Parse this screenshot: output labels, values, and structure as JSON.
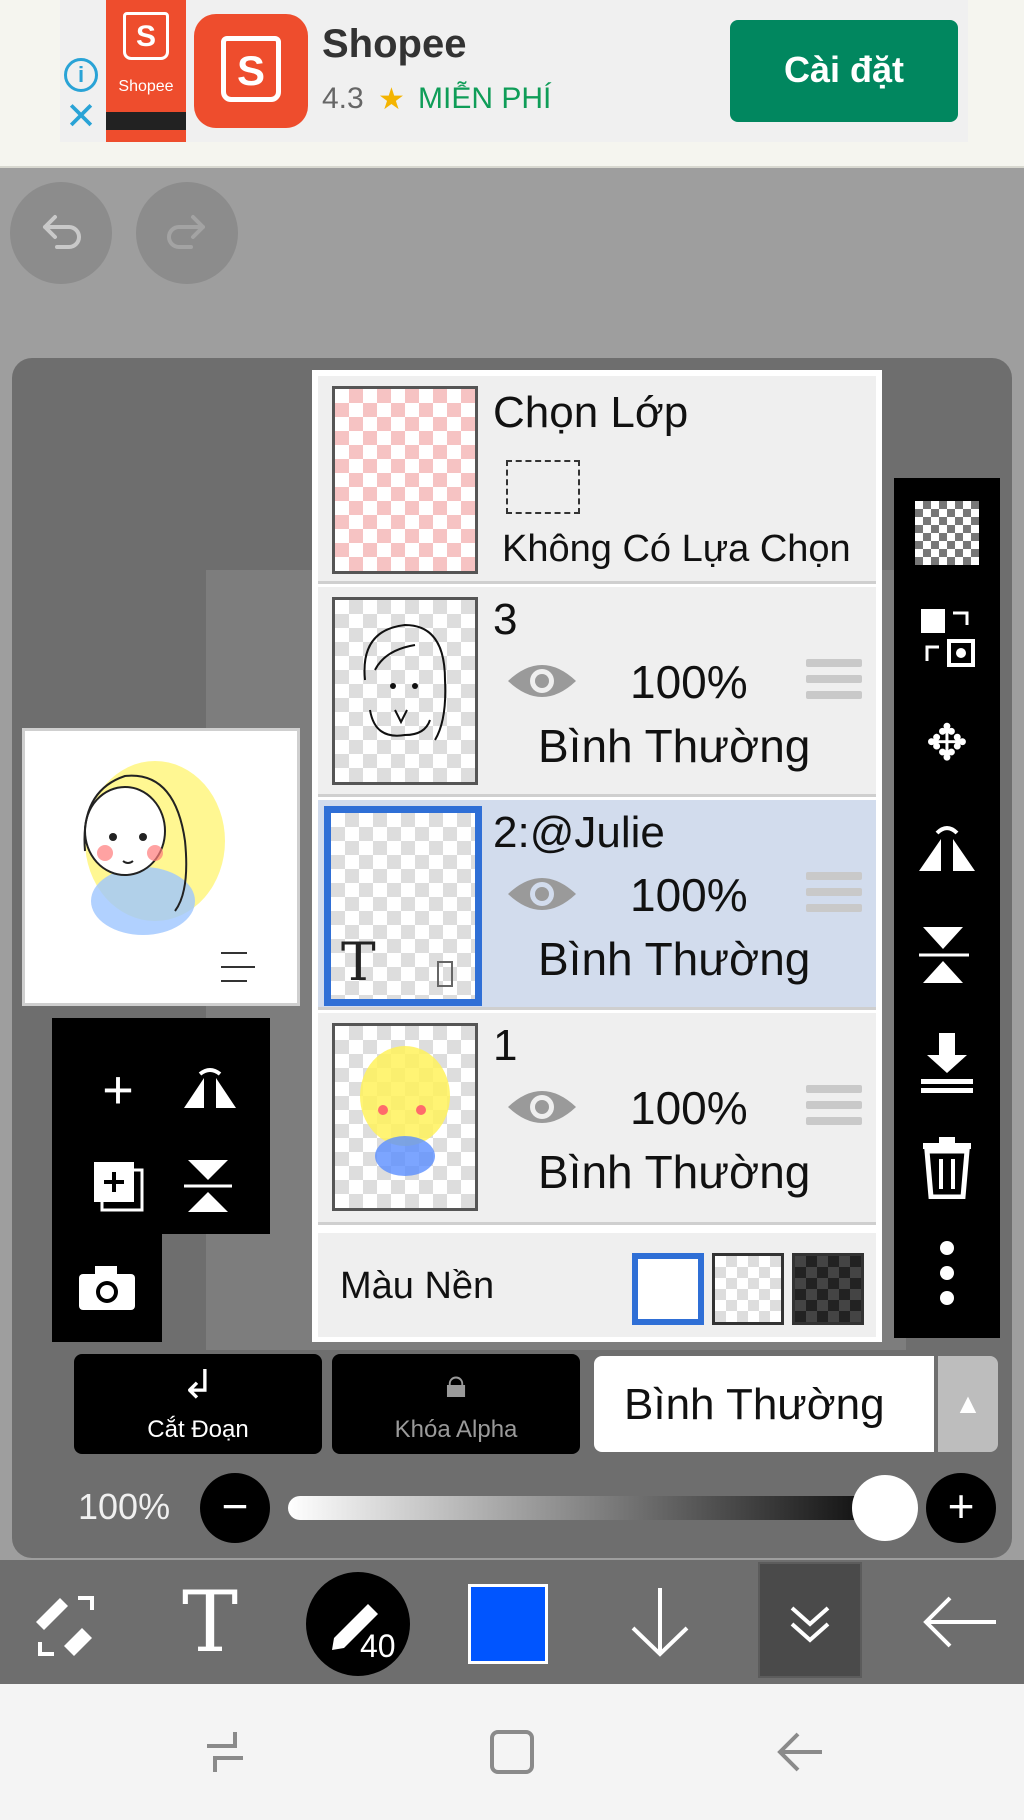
{
  "ad": {
    "thumb_label": "Shopee",
    "title": "Shopee",
    "rating": "4.3",
    "price": "MIỄN PHÍ",
    "install_label": "Cài đặt",
    "info_icon": "info-icon",
    "close_icon": "close-icon"
  },
  "toolbar_top": {
    "undo_icon": "undo-icon",
    "redo_icon": "redo-icon"
  },
  "layers_panel": {
    "selection": {
      "title": "Chọn Lớp",
      "status": "Không Có Lựa Chọn"
    },
    "layers": [
      {
        "name": "3",
        "opacity": "100%",
        "blend": "Bình Thường",
        "selected": false
      },
      {
        "name": "2:@Julie",
        "opacity": "100%",
        "blend": "Bình Thường",
        "selected": true
      },
      {
        "name": "1",
        "opacity": "100%",
        "blend": "Bình Thường",
        "selected": false
      }
    ],
    "background": {
      "label": "Màu Nền",
      "options": [
        "white",
        "transparent",
        "dark"
      ],
      "selected": "white"
    }
  },
  "layer_controls": {
    "cut_label": "Cắt Đoạn",
    "alpha_lock_label": "Khóa Alpha",
    "blend_mode": "Bình Thường",
    "opacity_label": "100%",
    "opacity_value": 1.0
  },
  "bottom_toolbar": {
    "brush_size": "40",
    "current_color": "#0055ff"
  },
  "colors": {
    "accent_blue": "#2f6fd6",
    "selected_row": "#d2dced",
    "install_green": "#01875f",
    "shopee_orange": "#ee4d2d"
  }
}
